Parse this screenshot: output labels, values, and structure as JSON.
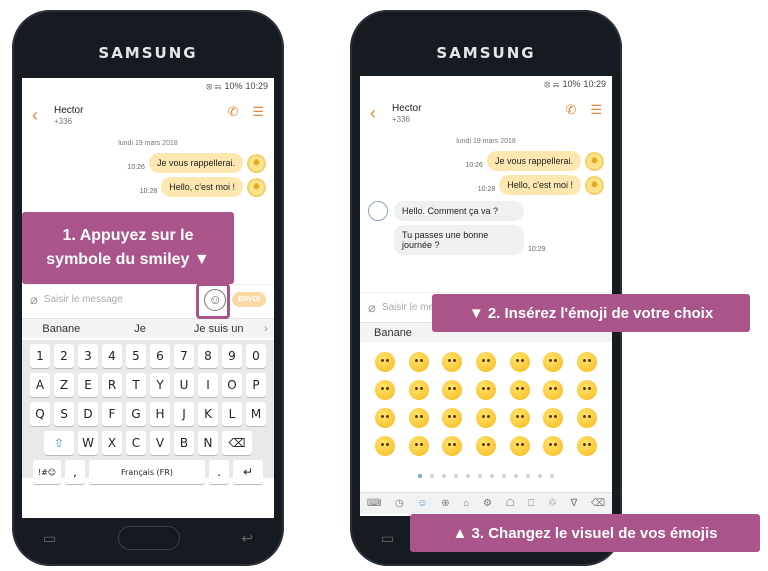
{
  "phone_brand": "SAMSUNG",
  "status": {
    "signal": "⦻ ☴",
    "battery": "10%",
    "time": "10:29"
  },
  "contact": {
    "name": "Hector",
    "number": "+336"
  },
  "chat": {
    "date": "lundi 19 mars 2018",
    "outgoing": [
      {
        "text": "Je vous rappellerai.",
        "time": "10:26"
      },
      {
        "text": "Hello, c'est moi !",
        "time": "10:28"
      }
    ],
    "incoming": [
      {
        "text": "Hello. Comment ça va ?"
      },
      {
        "text": "Tu passes une bonne journée ?",
        "time": "10:29"
      }
    ]
  },
  "composer": {
    "placeholder": "Saisir le message",
    "send_label": "ENVOI"
  },
  "suggestions": [
    "Banane",
    "Je",
    "Je suis un"
  ],
  "keyboard": {
    "row1": [
      "1",
      "2",
      "3",
      "4",
      "5",
      "6",
      "7",
      "8",
      "9",
      "0"
    ],
    "row2": [
      "A",
      "Z",
      "E",
      "R",
      "T",
      "Y",
      "U",
      "I",
      "O",
      "P"
    ],
    "row3": [
      "Q",
      "S",
      "D",
      "F",
      "G",
      "H",
      "J",
      "K",
      "L",
      "M"
    ],
    "row4": [
      "W",
      "X",
      "C",
      "V",
      "B",
      "N"
    ],
    "symbols": "!#☺",
    "comma": ",",
    "space": "Français (FR)",
    "period": "."
  },
  "emoji_tabs": [
    "⌨",
    "◷",
    "☺",
    "⊕",
    "⌂",
    "⚙",
    "☖",
    "⎕",
    "♲",
    "∇",
    "⌫"
  ],
  "callouts": {
    "step1": "1. Appuyez sur le symbole du smiley ▼",
    "step2": "▼ 2. Insérez l'émoji de votre choix",
    "step3": "▲ 3. Changez le visuel de vos émojis"
  },
  "colors": {
    "accent": "#e38a3a",
    "callout": "#a9558a",
    "bubble_out": "#fde7b0"
  }
}
